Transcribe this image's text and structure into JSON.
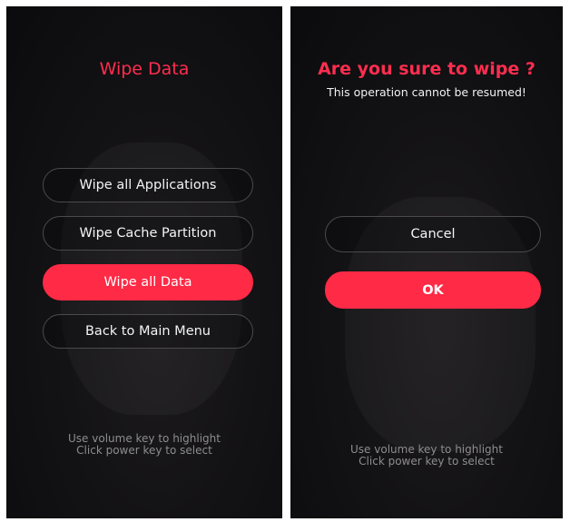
{
  "left_screen": {
    "title": "Wipe Data",
    "menu": [
      {
        "label": "Wipe all Applications",
        "selected": false
      },
      {
        "label": "Wipe Cache Partition",
        "selected": false
      },
      {
        "label": "Wipe all Data",
        "selected": true
      },
      {
        "label": "Back to Main Menu",
        "selected": false
      }
    ],
    "hint_line1": "Use volume key to highlight",
    "hint_line2": "Click power key to select"
  },
  "right_screen": {
    "title": "Are you sure to wipe ?",
    "subtitle": "This operation cannot be resumed!",
    "buttons": [
      {
        "label": "Cancel",
        "selected": false
      },
      {
        "label": "OK",
        "selected": true
      }
    ],
    "hint_line1": "Use volume key to highlight",
    "hint_line2": "Click power key to select"
  },
  "colors": {
    "accent": "#ff2a46",
    "title": "#ff2d4f",
    "background": "#111113",
    "hint_text": "#8c8c92"
  }
}
